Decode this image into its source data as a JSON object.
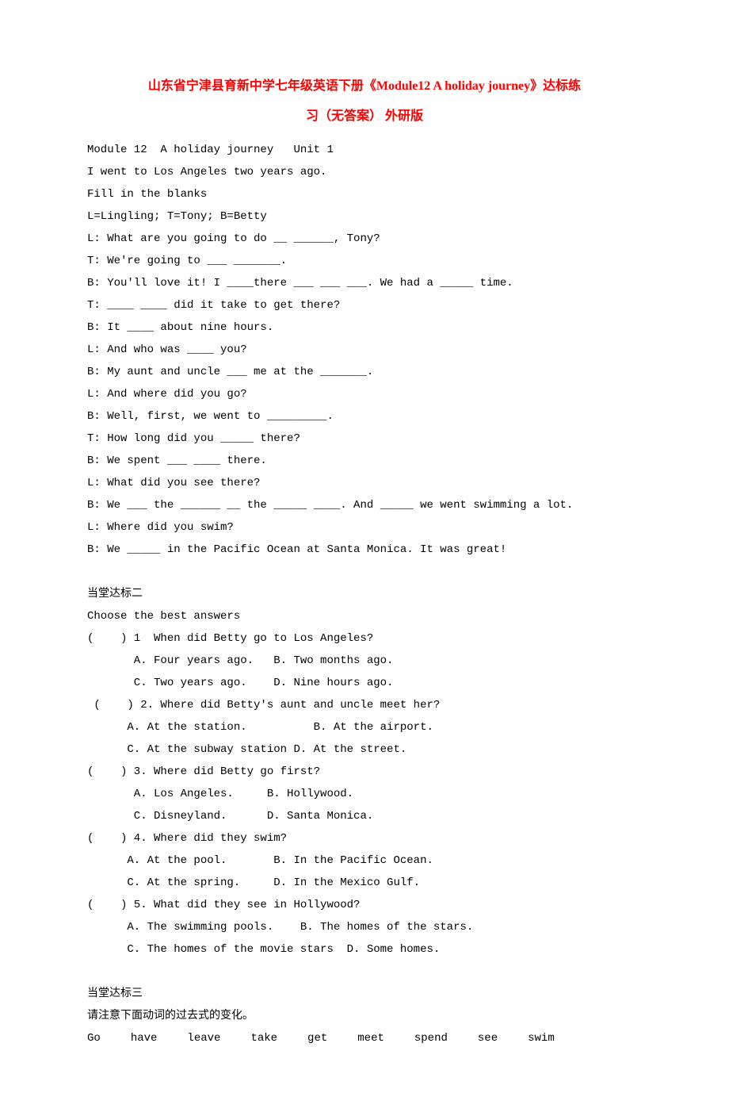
{
  "title_line1": "山东省宁津县育新中学七年级英语下册《Module12 A holiday journey》达标练",
  "title_line2": "习（无答案） 外研版",
  "intro": {
    "l1": "Module 12  A holiday journey   Unit 1",
    "l2": "I went to Los Angeles two years ago.",
    "l3": "Fill in the blanks",
    "l4": "L=Lingling; T=Tony; B=Betty"
  },
  "dialogue": {
    "d1": "L: What are you going to do __ ______, Tony?",
    "d2": "T: We're going to ___ _______.",
    "d3": "B: You'll love it! I ____there ___ ___ ___. We had a _____ time.",
    "d4": "T: ____ ____ did it take to get there?",
    "d5": "B: It ____ about nine hours.",
    "d6": "L: And who was ____ you?",
    "d7": "B: My aunt and uncle ___ me at the _______.",
    "d8": "L: And where did you go?",
    "d9": "B: Well, first, we went to _________.",
    "d10": "T: How long did you _____ there?",
    "d11": "B: We spent ___ ____ there.",
    "d12": "L: What did you see there?",
    "d13": "B: We ___ the ______ __ the _____ ____. And _____ we went swimming a lot.",
    "d14": "L: Where did you swim?",
    "d15": "B: We _____ in the Pacific Ocean at Santa Monica. It was great!"
  },
  "section2": {
    "heading": "当堂达标二",
    "subtitle": "Choose the best answers",
    "q1": "(    ) 1  When did Betty go to Los Angeles?",
    "q1a": "       A. Four years ago.   B. Two months ago.",
    "q1b": "       C. Two years ago.    D. Nine hours ago.",
    "q2": " (    ) 2. Where did Betty's aunt and uncle meet her?",
    "q2a": "      A. At the station.          B. At the airport.",
    "q2b": "      C. At the subway station D. At the street.",
    "q3": "(    ) 3. Where did Betty go first?",
    "q3a": "       A. Los Angeles.     B. Hollywood.",
    "q3b": "       C. Disneyland.      D. Santa Monica.",
    "q4": "(    ) 4. Where did they swim?",
    "q4a": "      A. At the pool.       B. In the Pacific Ocean.",
    "q4b": "      C. At the spring.     D. In the Mexico Gulf.",
    "q5": "(    ) 5. What did they see in Hollywood?",
    "q5a": "      A. The swimming pools.    B. The homes of the stars.",
    "q5b": "      C. The homes of the movie stars  D. Some homes."
  },
  "section3": {
    "heading": "当堂达标三",
    "subtitle": "请注意下面动词的过去式的变化。",
    "verbs": [
      "Go",
      "have",
      "leave",
      "take",
      "get",
      "meet",
      "spend",
      "see",
      "swim"
    ]
  }
}
